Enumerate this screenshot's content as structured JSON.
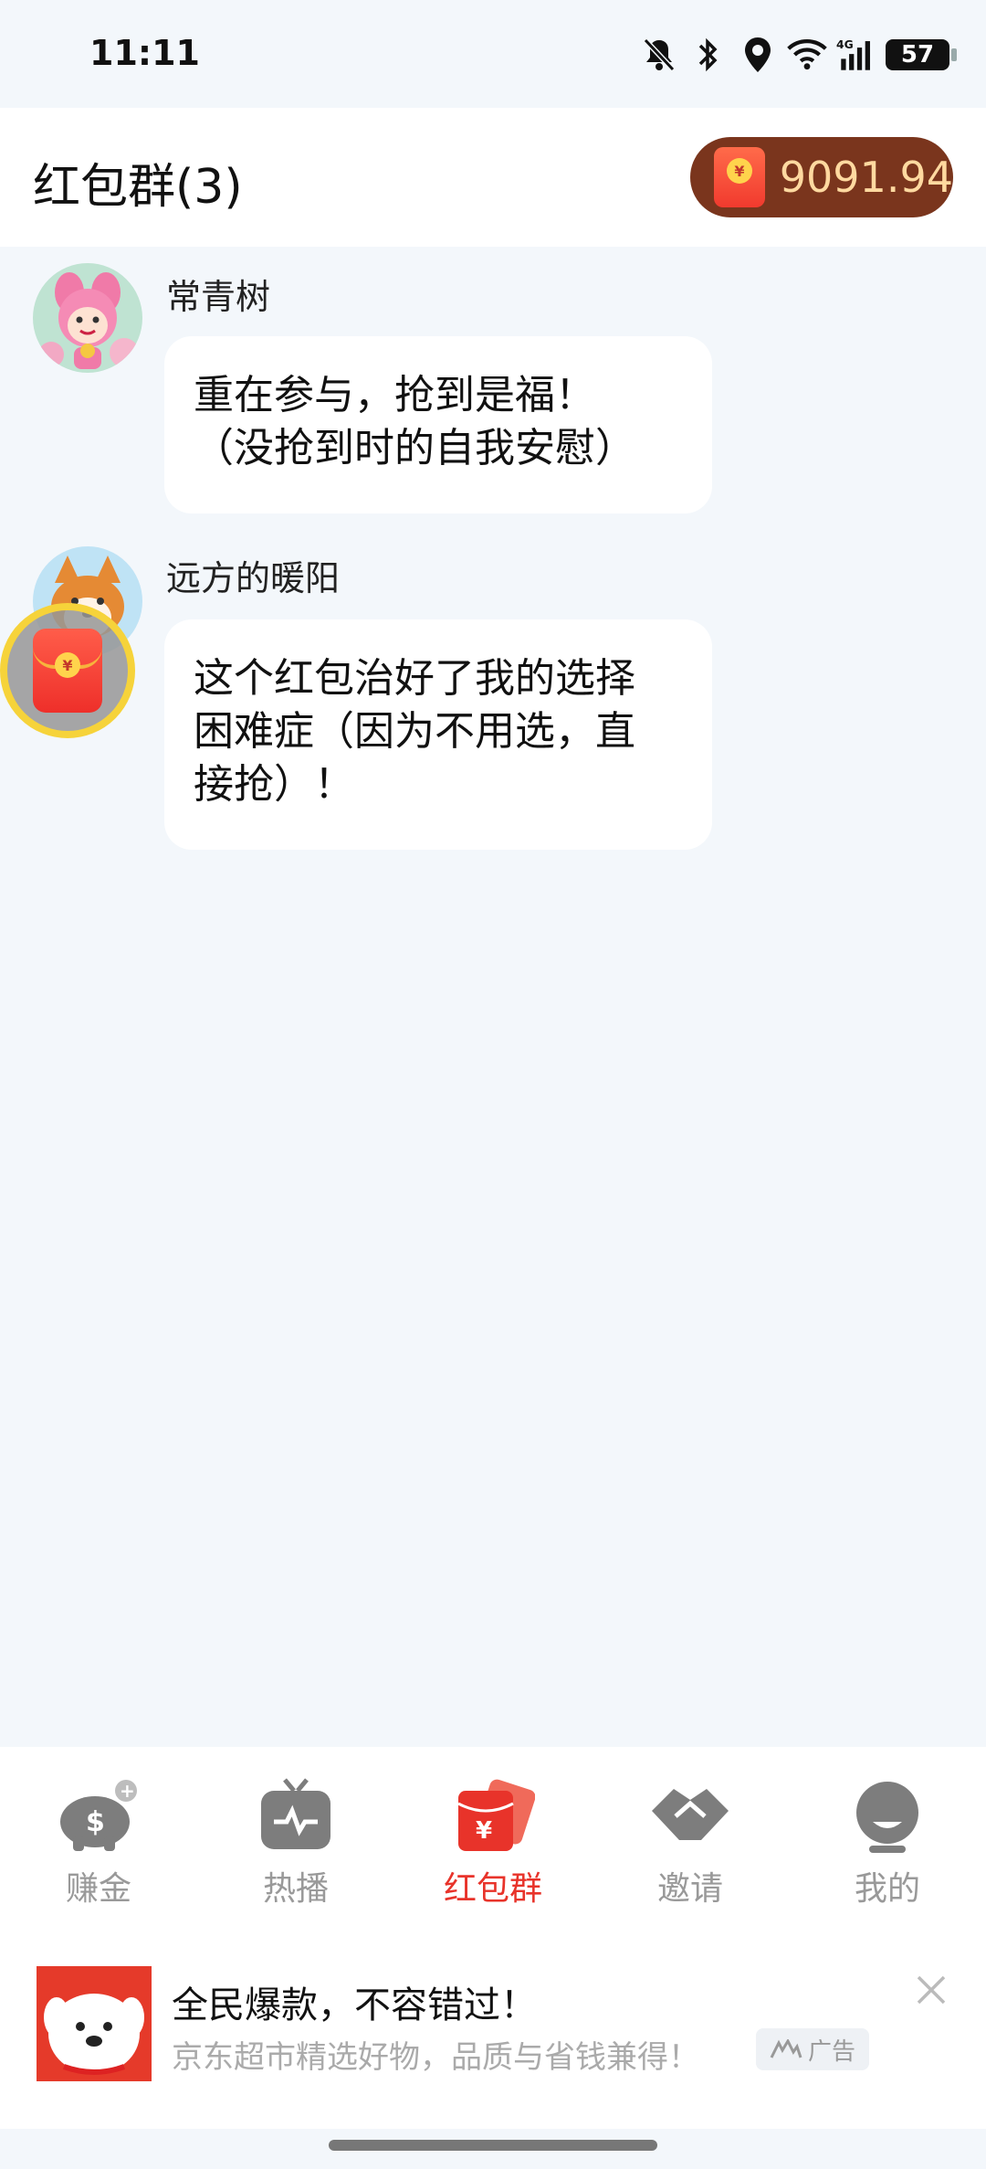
{
  "status_bar": {
    "time": "11:11",
    "battery": "57",
    "icons": [
      "bell-off-icon",
      "bluetooth-icon",
      "location-icon",
      "wifi-icon",
      "cellular-4g-icon",
      "battery-icon"
    ]
  },
  "header": {
    "title": "红包群(3)",
    "balance": "9091.94"
  },
  "messages": [
    {
      "sender": "常青树",
      "text_line1": "重在参与，抢到是福！",
      "text_line2": "（没抢到时的自我安慰）"
    },
    {
      "sender": "远方的暖阳",
      "text_line1": "这个红包治好了我的选择",
      "text_line2": "困难症（因为不用选，直",
      "text_line3": "接抢）！"
    }
  ],
  "nav": {
    "items": [
      {
        "label": "赚金",
        "icon": "piggy-bank-icon",
        "active": false
      },
      {
        "label": "热播",
        "icon": "tv-icon",
        "active": false
      },
      {
        "label": "红包群",
        "icon": "red-envelope-icon",
        "active": true
      },
      {
        "label": "邀请",
        "icon": "handshake-icon",
        "active": false
      },
      {
        "label": "我的",
        "icon": "profile-icon",
        "active": false
      }
    ]
  },
  "ad": {
    "title": "全民爆款，不容错过！",
    "subtitle": "京东超市精选好物，品质与省钱兼得！",
    "badge": "广告"
  },
  "colors": {
    "accent_red": "#e8332a",
    "balance_pill": "#7a351d",
    "balance_text": "#ffd9a0",
    "background": "#f3f7fb"
  }
}
